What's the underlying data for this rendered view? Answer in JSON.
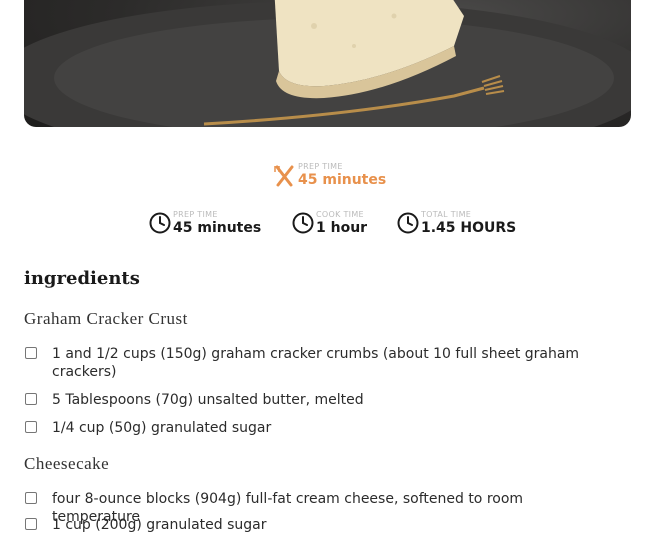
{
  "highlight": {
    "icon": "utensils-icon",
    "label": "PREP TIME",
    "value": "45 minutes",
    "color": "#e8914c"
  },
  "times": [
    {
      "icon": "clock-icon",
      "label": "PREP TIME",
      "value": "45 minutes"
    },
    {
      "icon": "clock-icon",
      "label": "COOK TIME",
      "value": "1 hour"
    },
    {
      "icon": "clock-icon",
      "label": "TOTAL TIME",
      "value": "1.45 hours"
    }
  ],
  "ingredients": {
    "heading": "ingredients",
    "groups": [
      {
        "title": "Graham Cracker Crust",
        "items": [
          "1 and 1/2 cups (150g) graham cracker crumbs (about 10 full sheet graham crackers)",
          "5 Tablespoons (70g) unsalted butter, melted",
          "1/4 cup (50g) granulated sugar"
        ]
      },
      {
        "title": "Cheesecake",
        "items": [
          "four 8-ounce blocks (904g) full-fat cream cheese, softened to room temperature",
          "1 cup (200g) granulated sugar"
        ]
      }
    ]
  }
}
